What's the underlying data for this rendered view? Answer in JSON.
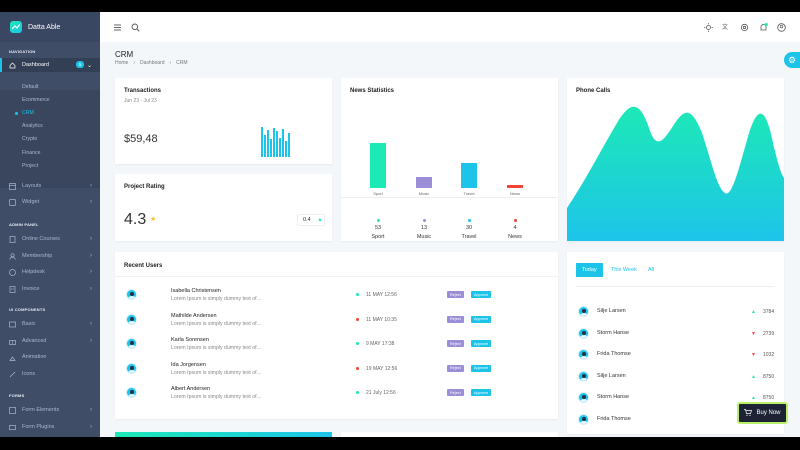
{
  "brand": "Datta Able",
  "sidebar": {
    "caption_navigation": "NAVIGATION",
    "dashboard": "Dashboard",
    "dashboard_badge": "5",
    "submenu": [
      "Default",
      "Ecommerce",
      "CRM",
      "Analytics",
      "Crypto",
      "Finance",
      "Project"
    ],
    "layouts": "Layouts",
    "widget": "Widget",
    "caption_admin": "ADMIN PANEL",
    "admin": [
      "Online Courses",
      "Membership",
      "Helpdesk",
      "Invoice"
    ],
    "caption_ui": "UI COMPONENTS",
    "ui": [
      "Basic",
      "Advanced",
      "Animation",
      "Icons"
    ],
    "caption_forms": "FORMS",
    "forms": [
      "Form Elements",
      "Form Plugins"
    ]
  },
  "page": {
    "title": "CRM",
    "breadcrumb": [
      "Home",
      "Dashboard",
      "CRM"
    ]
  },
  "transactions": {
    "title": "Transactions",
    "range": "Jun 23 - Jul 23",
    "amount": "$59,48",
    "bar_levels": [
      0.95,
      0.7,
      0.85,
      0.55,
      0.9,
      0.8,
      0.6,
      0.88,
      0.5,
      0.75
    ]
  },
  "rating": {
    "title": "Project Rating",
    "value": "4.3",
    "change": "0.4"
  },
  "news": {
    "title": "News Statistics",
    "items": [
      {
        "label": "Sport",
        "value": "53",
        "color": "#1de9b6",
        "level": 0.53
      },
      {
        "label": "Music",
        "value": "13",
        "color": "#9c8ed6",
        "level": 0.13
      },
      {
        "label": "Travel",
        "value": "30",
        "color": "#1dc4e9",
        "level": 0.3
      },
      {
        "label": "News",
        "value": "4",
        "color": "#f44236",
        "level": 0.04
      }
    ]
  },
  "phone": {
    "title": "Phone Calls"
  },
  "recent": {
    "title": "Recent Users",
    "users": [
      {
        "name": "Isabella Christensen",
        "text": "Lorem Ipsum is simply dummy text of…",
        "date": "11 MAY 12:56",
        "status": "#1de9b6"
      },
      {
        "name": "Mathilde Andersen",
        "text": "Lorem Ipsum is simply dummy text of…",
        "date": "11 MAY 10:35",
        "status": "#f44236"
      },
      {
        "name": "Karla Sorensen",
        "text": "Lorem Ipsum is simply dummy text of…",
        "date": "9 MAY 17:38",
        "status": "#1de9b6"
      },
      {
        "name": "Ida Jorgensen",
        "text": "Lorem Ipsum is simply dummy text of…",
        "date": "19 MAY 12:56",
        "status": "#f44236"
      },
      {
        "name": "Albert Andersen",
        "text": "Lorem Ipsum is simply dummy text of…",
        "date": "21 July 12:56",
        "status": "#1de9b6"
      }
    ],
    "reject_label": "Reject",
    "approve_label": "Approve"
  },
  "tabs": {
    "labels": [
      "Today",
      "This Week",
      "All"
    ],
    "rows": [
      {
        "name": "Silje Larsen",
        "value": "3784",
        "trend": "up"
      },
      {
        "name": "Storm Hanse",
        "value": "2739",
        "trend": "down"
      },
      {
        "name": "Frida Thomse",
        "value": "1032",
        "trend": "down"
      },
      {
        "name": "Silje Larsen",
        "value": "8750",
        "trend": "up"
      },
      {
        "name": "Storm Hanse",
        "value": "8750",
        "trend": "up"
      },
      {
        "name": "Frida Thomse",
        "value": "",
        "trend": ""
      }
    ]
  },
  "buy_now": "Buy Now",
  "colors": {
    "accent": "#1dc4e9",
    "green": "#1de9b6",
    "red": "#f44236",
    "purple": "#9c8ed6"
  }
}
